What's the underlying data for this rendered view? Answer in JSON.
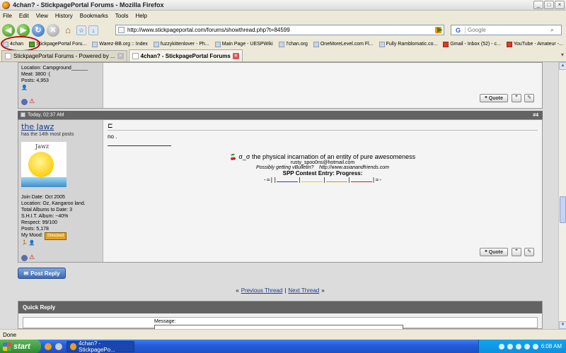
{
  "window": {
    "title": "4chan? - StickpagePortal Forums - Mozilla Firefox",
    "btn_min": "_",
    "btn_max": "□",
    "btn_close": "×"
  },
  "menu": [
    "File",
    "Edit",
    "View",
    "History",
    "Bookmarks",
    "Tools",
    "Help"
  ],
  "nav": {
    "url": "http://www.stickpageportal.com/forums/showthread.php?t=84599",
    "search_placeholder": "Google",
    "search_engine_glyph": "G"
  },
  "bookmarks": [
    {
      "label": "4chan",
      "icon": "page-icon"
    },
    {
      "label": "StickpagePortal Foru...",
      "icon": "page-icon"
    },
    {
      "label": "Warez-BB.org :: Index",
      "icon": "page-icon"
    },
    {
      "label": "fuzzykittenlover - Ph...",
      "icon": "page-icon"
    },
    {
      "label": "Main Page - UESPWiki",
      "icon": "page-icon"
    },
    {
      "label": "7chan.org",
      "icon": "page-icon"
    },
    {
      "label": "OneMoreLevel.com Fl...",
      "icon": "page-icon"
    },
    {
      "label": "Fully Ramblomatic.co...",
      "icon": "page-icon"
    },
    {
      "label": "Gmail - Inbox (52) - c...",
      "icon": "gmail-icon"
    },
    {
      "label": "YouTube - Amateur -...",
      "icon": "youtube-icon"
    }
  ],
  "tabs": [
    {
      "label": "StickpagePortal Forums - Powered by ...",
      "active": false
    },
    {
      "label": "4chan? - StickpagePortal Forums",
      "active": true
    }
  ],
  "prev_post": {
    "location": "Location: Campground______",
    "meat": "Meat: 3800 :(",
    "posts": "Posts: 4,953"
  },
  "post": {
    "date": "Today, 02:37 AM",
    "number": "#4",
    "username": "the Jawz",
    "user_title": "has the 14th most posts",
    "avatar_text": "Jawz",
    "join_date": "Join Date: Oct 2005",
    "location": "Location: Oz, Kangaroo land.",
    "albums": "Total Albums to Date: 3",
    "shit_album": "S.H.I.T. Album: ~40%",
    "respect": "Respect: 99/100",
    "posts": "Posts: 5,178",
    "mood_label": "My Mood:",
    "mood_value": "Shocked",
    "body": "no .",
    "sig_title": "σ_σ  the physical incarnation of an entity of pure awesomeness",
    "sig_email": "rusty_spoo0ns@hotmail.com",
    "sig_vb": "Possibly getting vBulletin?",
    "sig_link": "http://www.asianandfriends.com",
    "sig_contest": "SPP Contest Entry: Progress:",
    "progress_left": "-=||",
    "progress_right": "|=-",
    "progress_colors": [
      "#2244aa",
      "#e8d200",
      "#e89000",
      "#cc2222"
    ]
  },
  "buttons": {
    "quote": "Quote",
    "post_reply": "Post Reply"
  },
  "thread_nav": {
    "prev": "Previous Thread",
    "next": "Next Thread",
    "sep": "|",
    "left_arrows": "«",
    "right_arrows": "»"
  },
  "quick_reply": {
    "title": "Quick Reply",
    "message_label": "Message:"
  },
  "status": "Done",
  "taskbar": {
    "start": "start",
    "task": "4chan? - StickpagePo...",
    "time": "6:08 AM"
  }
}
